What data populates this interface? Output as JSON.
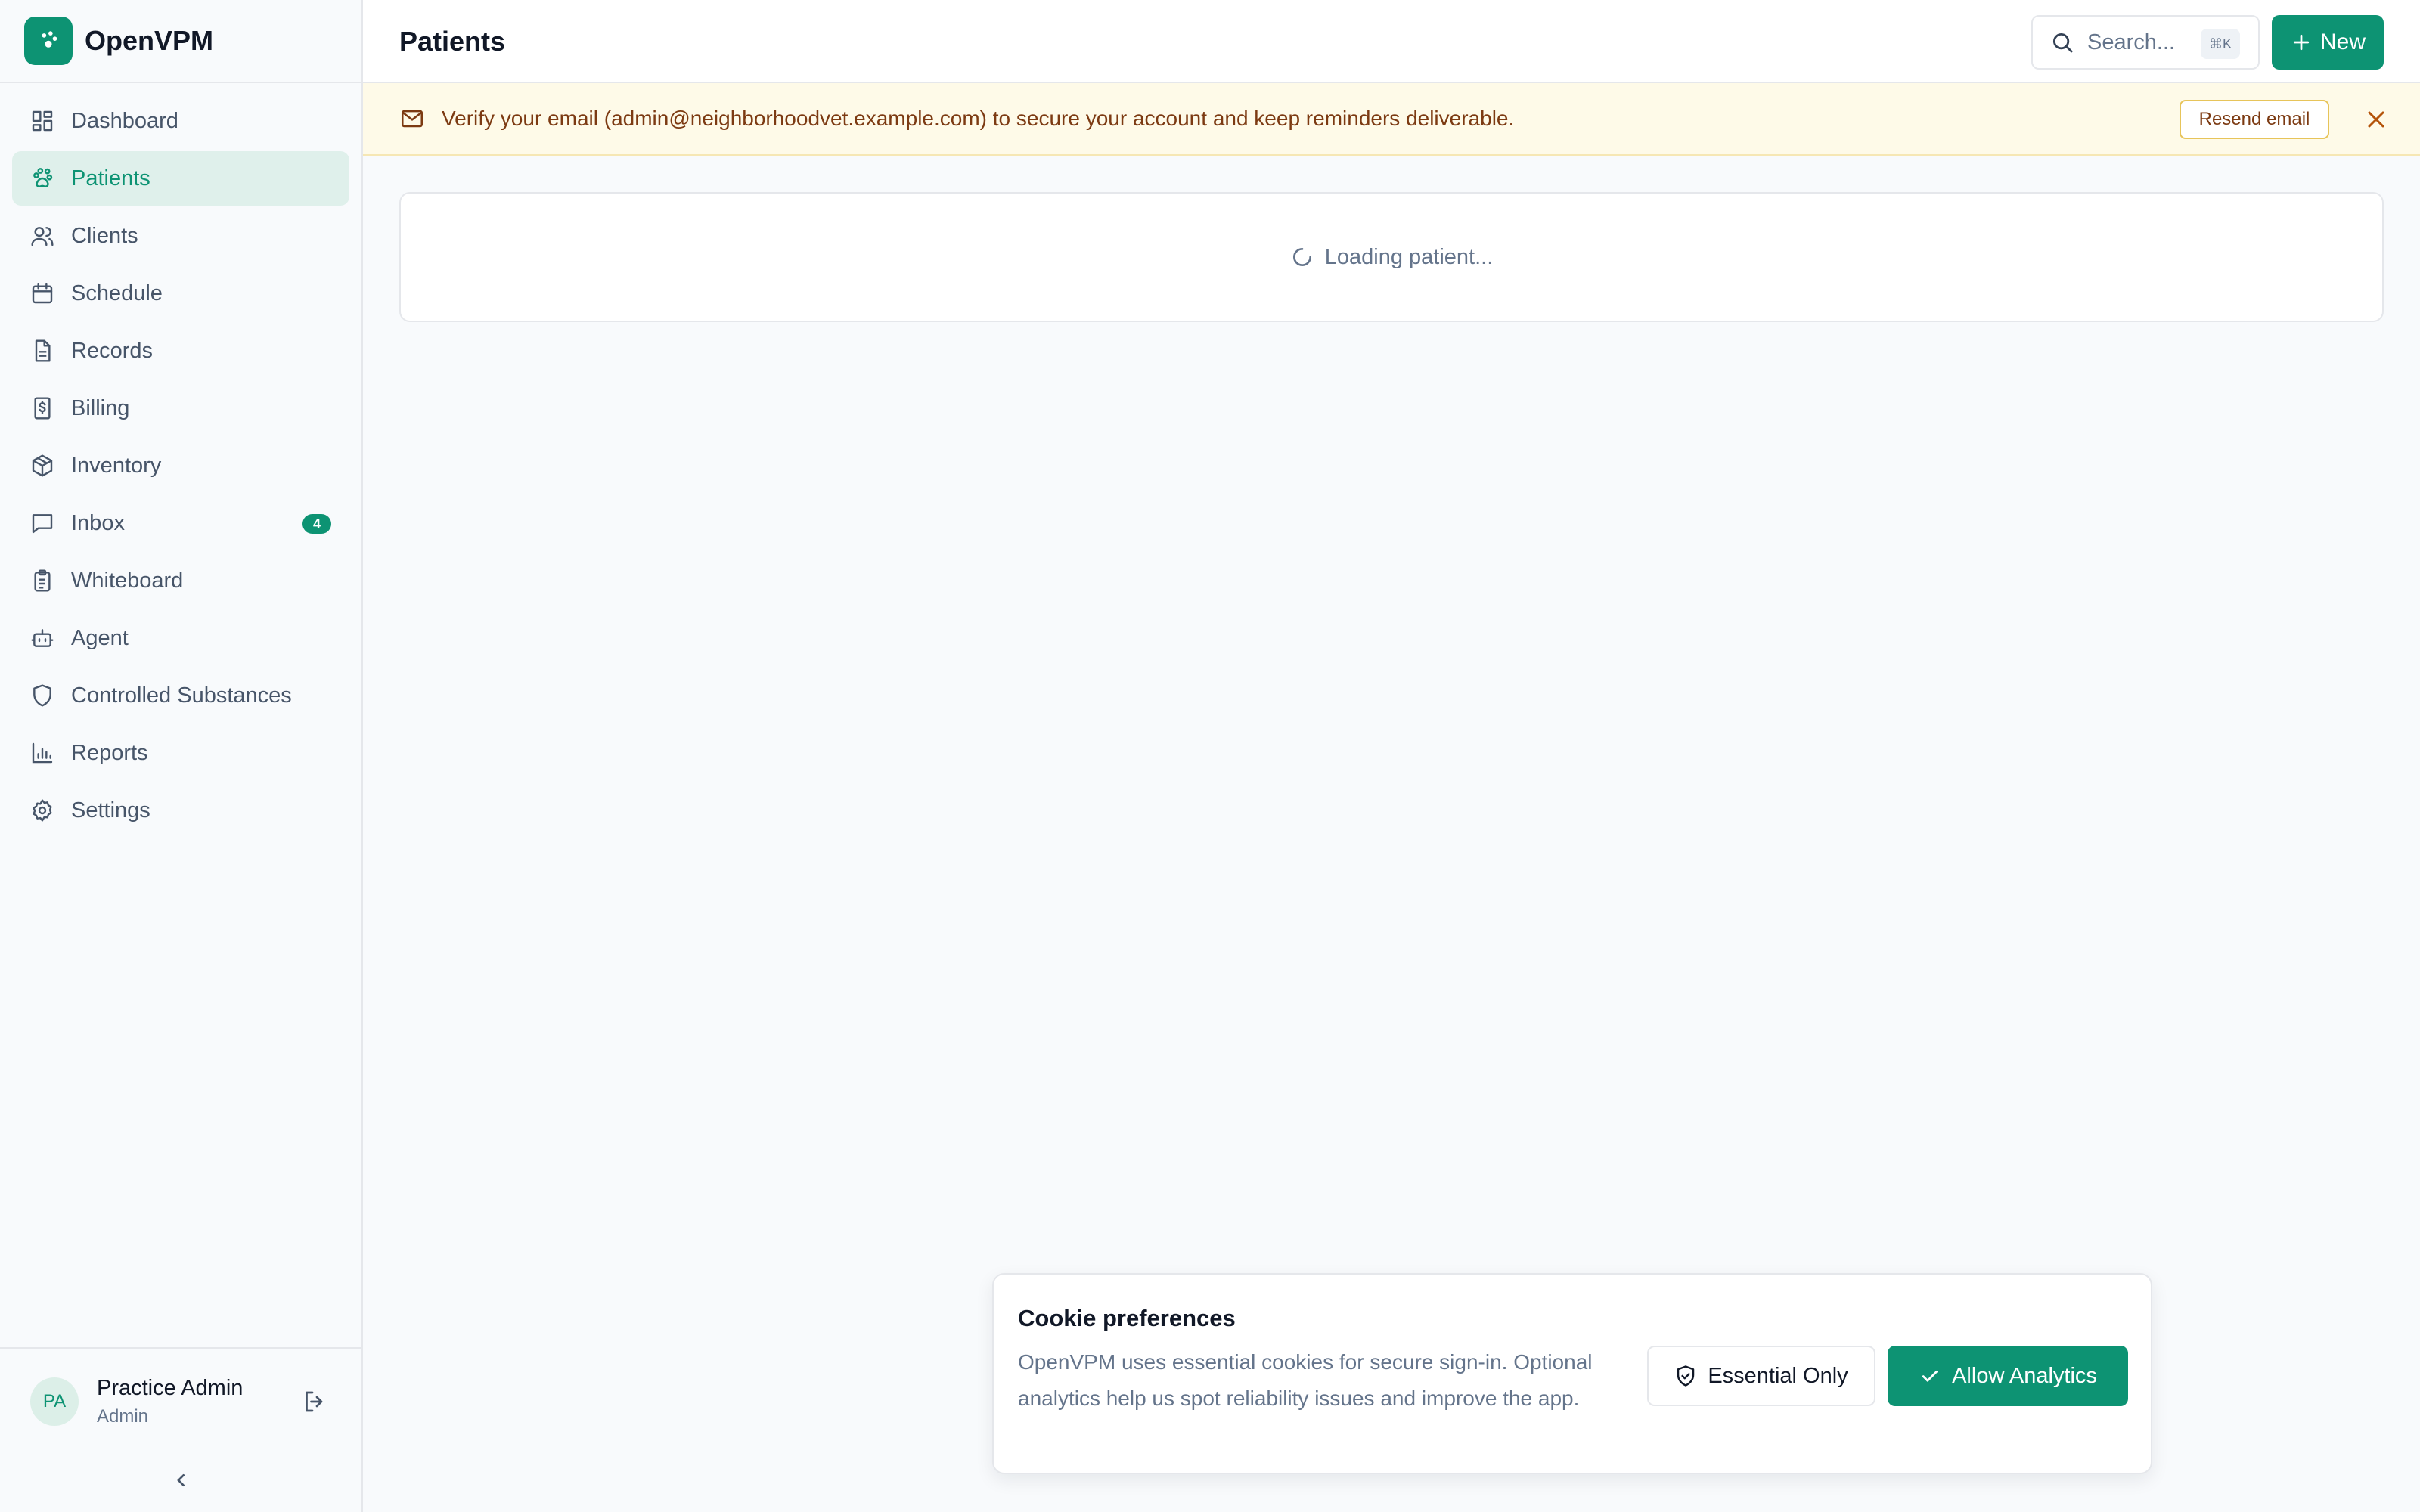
{
  "app": {
    "name": "OpenVPM",
    "accent": "#0d9373"
  },
  "sidebar": {
    "items": [
      {
        "label": "Dashboard",
        "icon": "dashboard-icon",
        "active": false
      },
      {
        "label": "Patients",
        "icon": "paw-icon",
        "active": true
      },
      {
        "label": "Clients",
        "icon": "users-icon",
        "active": false
      },
      {
        "label": "Schedule",
        "icon": "calendar-icon",
        "active": false
      },
      {
        "label": "Records",
        "icon": "document-icon",
        "active": false
      },
      {
        "label": "Billing",
        "icon": "receipt-icon",
        "active": false
      },
      {
        "label": "Inventory",
        "icon": "box-icon",
        "active": false
      },
      {
        "label": "Inbox",
        "icon": "message-icon",
        "active": false,
        "badge": "4"
      },
      {
        "label": "Whiteboard",
        "icon": "clipboard-icon",
        "active": false
      },
      {
        "label": "Agent",
        "icon": "bot-icon",
        "active": false
      },
      {
        "label": "Controlled Substances",
        "icon": "shield-icon",
        "active": false
      },
      {
        "label": "Reports",
        "icon": "bar-chart-icon",
        "active": false
      },
      {
        "label": "Settings",
        "icon": "gear-icon",
        "active": false
      }
    ],
    "user": {
      "initials": "PA",
      "name": "Practice Admin",
      "role": "Admin"
    }
  },
  "header": {
    "title": "Patients",
    "search_placeholder": "Search...",
    "search_shortcut": "⌘K",
    "new_label": "New"
  },
  "banner": {
    "text": "Verify your email (admin@neighborhoodvet.example.com) to secure your account and keep reminders deliverable.",
    "resend_label": "Resend email"
  },
  "main": {
    "loading_text": "Loading patient..."
  },
  "cookie": {
    "title": "Cookie preferences",
    "text": "OpenVPM uses essential cookies for secure sign-in. Optional analytics help us spot reliability issues and improve the app.",
    "essential_label": "Essential Only",
    "allow_label": "Allow Analytics"
  }
}
